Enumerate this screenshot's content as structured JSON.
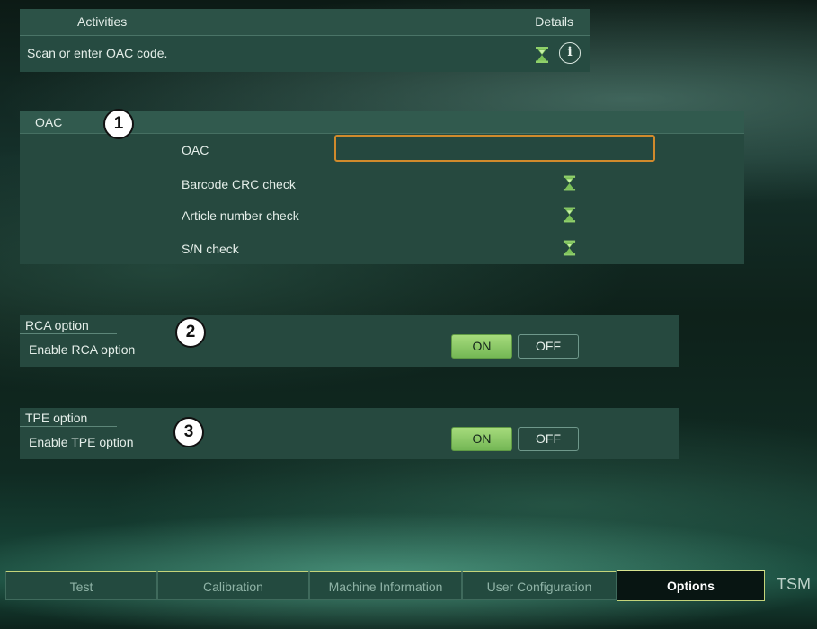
{
  "activities": {
    "col_activities": "Activities",
    "col_details": "Details",
    "message": "Scan or enter OAC code.",
    "icons": [
      "hourglass-icon",
      "info-icon"
    ]
  },
  "oac_section": {
    "title": "OAC",
    "badge": "1",
    "fields": {
      "oac_label": "OAC",
      "oac_value": "",
      "barcode_crc": "Barcode CRC check",
      "article_number": "Article number check",
      "sn_check": "S/N check"
    },
    "status_icon": "hourglass-icon"
  },
  "rca_section": {
    "title": "RCA option",
    "badge": "2",
    "label": "Enable RCA option",
    "on": "ON",
    "off": "OFF",
    "selected": "ON"
  },
  "tpe_section": {
    "title": "TPE option",
    "badge": "3",
    "label": "Enable TPE option",
    "on": "ON",
    "off": "OFF",
    "selected": "ON"
  },
  "tabs": [
    "Test",
    "Calibration",
    "Machine Information",
    "User Configuration",
    "Options"
  ],
  "active_tab": "Options",
  "brand": "TSM",
  "colors": {
    "accent_green": "#8fcd69",
    "input_border": "#d08a2c",
    "tab_border": "#c4d47a"
  }
}
